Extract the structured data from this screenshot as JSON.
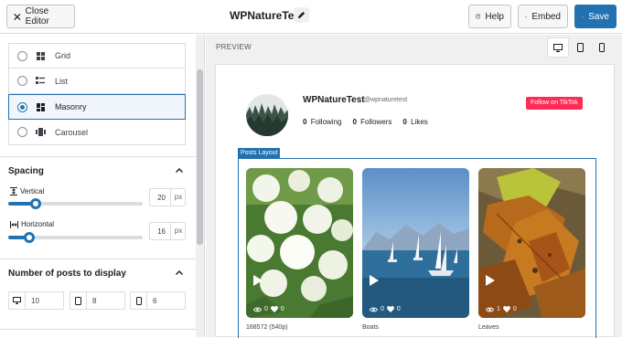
{
  "topbar": {
    "close_label": "Close Editor",
    "title": "WPNatureTest",
    "help_label": "Help",
    "embed_label": "Embed",
    "save_label": "Save"
  },
  "sidebar": {
    "layouts": [
      {
        "label": "Grid",
        "icon": "grid-icon",
        "selected": false
      },
      {
        "label": "List",
        "icon": "list-icon",
        "selected": false
      },
      {
        "label": "Masonry",
        "icon": "masonry-icon",
        "selected": true
      },
      {
        "label": "Carousel",
        "icon": "carousel-icon",
        "selected": false
      }
    ],
    "spacing": {
      "title": "Spacing",
      "vertical": {
        "label": "Vertical",
        "value": "20",
        "unit": "px",
        "slider_fraction": 0.2
      },
      "horizontal": {
        "label": "Horizontal",
        "value": "16",
        "unit": "px",
        "slider_fraction": 0.16
      }
    },
    "posts": {
      "title": "Number of posts to display",
      "desktop": "10",
      "tablet": "8",
      "mobile": "6"
    }
  },
  "preview": {
    "label": "PREVIEW",
    "profile": {
      "username": "WPNatureTest",
      "handle": "@wpnaturetest",
      "following_count": "0",
      "following_label": "Following",
      "followers_count": "0",
      "followers_label": "Followers",
      "likes_count": "0",
      "likes_label": "Likes",
      "follow_button": "Follow on TikTok"
    },
    "posts_tag": "Posts Layout",
    "posts": [
      {
        "caption": "168572 (540p)",
        "views": "0",
        "likes": "0"
      },
      {
        "caption": "Boats",
        "views": "0",
        "likes": "0"
      },
      {
        "caption": "Leaves",
        "views": "1",
        "likes": "0"
      }
    ]
  },
  "colors": {
    "accent": "#2271b1",
    "tiktok": "#fe2c55"
  }
}
